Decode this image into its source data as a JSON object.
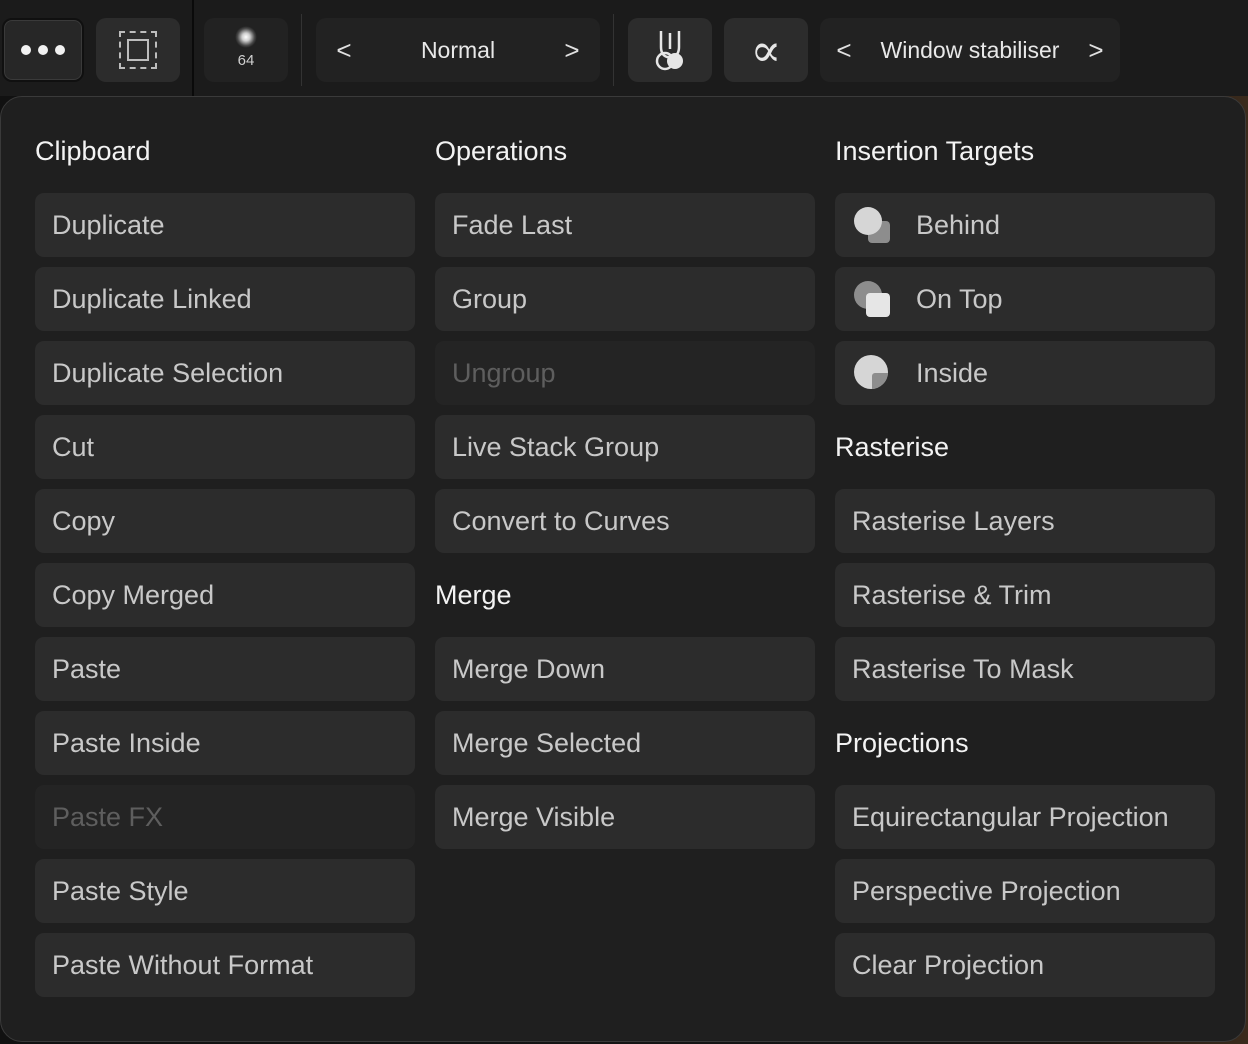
{
  "toolbar": {
    "brush_size": "64",
    "blend_mode": "Normal",
    "stabiliser": "Window stabiliser",
    "prev_chevron": "<",
    "next_chevron": ">",
    "alpha_glyph": "∝"
  },
  "panel": {
    "clipboard": {
      "heading": "Clipboard",
      "items": [
        {
          "label": "Duplicate",
          "enabled": true
        },
        {
          "label": "Duplicate Linked",
          "enabled": true
        },
        {
          "label": "Duplicate Selection",
          "enabled": true
        },
        {
          "label": "Cut",
          "enabled": true
        },
        {
          "label": "Copy",
          "enabled": true
        },
        {
          "label": "Copy Merged",
          "enabled": true
        },
        {
          "label": "Paste",
          "enabled": true
        },
        {
          "label": "Paste Inside",
          "enabled": true
        },
        {
          "label": "Paste FX",
          "enabled": false
        },
        {
          "label": "Paste Style",
          "enabled": true
        },
        {
          "label": "Paste Without Format",
          "enabled": true
        }
      ]
    },
    "operations": {
      "heading": "Operations",
      "items": [
        {
          "label": "Fade Last",
          "enabled": true
        },
        {
          "label": "Group",
          "enabled": true
        },
        {
          "label": "Ungroup",
          "enabled": false
        },
        {
          "label": "Live Stack Group",
          "enabled": true
        },
        {
          "label": "Convert to Curves",
          "enabled": true
        }
      ]
    },
    "merge": {
      "heading": "Merge",
      "items": [
        {
          "label": "Merge Down",
          "enabled": true
        },
        {
          "label": "Merge Selected",
          "enabled": true
        },
        {
          "label": "Merge Visible",
          "enabled": true
        }
      ]
    },
    "insertion_targets": {
      "heading": "Insertion Targets",
      "items": [
        {
          "label": "Behind",
          "icon": "insert-behind-icon"
        },
        {
          "label": "On Top",
          "icon": "insert-on-top-icon"
        },
        {
          "label": "Inside",
          "icon": "insert-inside-icon"
        }
      ]
    },
    "rasterise": {
      "heading": "Rasterise",
      "items": [
        {
          "label": "Rasterise Layers",
          "enabled": true
        },
        {
          "label": "Rasterise & Trim",
          "enabled": true
        },
        {
          "label": "Rasterise To Mask",
          "enabled": true
        }
      ]
    },
    "projections": {
      "heading": "Projections",
      "items": [
        {
          "label": "Equirectangular Projection",
          "enabled": true
        },
        {
          "label": "Perspective Projection",
          "enabled": true
        },
        {
          "label": "Clear Projection",
          "enabled": true
        }
      ]
    }
  },
  "colors": {
    "panel_bg": "#1f1f1f",
    "item_bg": "#2c2c2c",
    "item_text": "#c8c8c8",
    "disabled_text": "#5e5e5e",
    "heading_text": "#f3f3f3"
  }
}
